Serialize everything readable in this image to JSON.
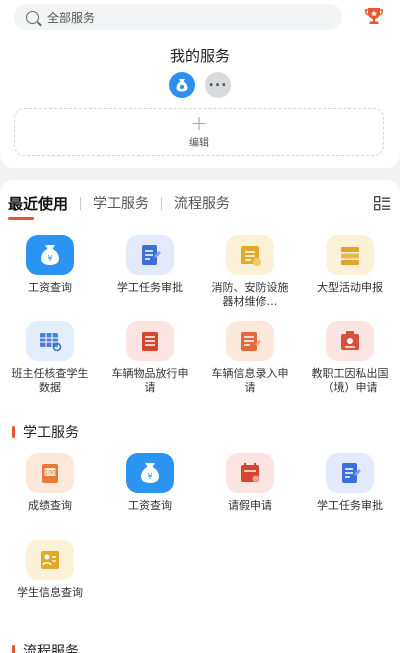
{
  "search": {
    "placeholder": "全部服务"
  },
  "my_services": {
    "title": "我的服务",
    "edit_label": "编辑"
  },
  "tabs": [
    {
      "label": "最近使用",
      "active": true
    },
    {
      "label": "学工服务",
      "active": false
    },
    {
      "label": "流程服务",
      "active": false
    }
  ],
  "recent": [
    {
      "label": "工资查询",
      "icon": "money-bag-icon"
    },
    {
      "label": "学工任务审批",
      "icon": "approval-doc-icon"
    },
    {
      "label": "消防、安防设施器材维修…",
      "icon": "repair-doc-icon"
    },
    {
      "label": "大型活动申报",
      "icon": "event-stack-icon"
    },
    {
      "label": "班主任核查学生数据",
      "icon": "data-check-icon"
    },
    {
      "label": "车辆物品放行申请",
      "icon": "vehicle-pass-icon"
    },
    {
      "label": "车辆信息录入申请",
      "icon": "vehicle-info-icon"
    },
    {
      "label": "教职工因私出国（境）申请",
      "icon": "travel-abroad-icon"
    }
  ],
  "student_affairs": {
    "title": "学工服务",
    "items": [
      {
        "label": "成绩查询",
        "icon": "score-icon"
      },
      {
        "label": "工资查询",
        "icon": "money-bag-icon"
      },
      {
        "label": "请假申请",
        "icon": "leave-calendar-icon"
      },
      {
        "label": "学工任务审批",
        "icon": "approval-doc-icon"
      },
      {
        "label": "学生信息查询",
        "icon": "student-info-icon"
      }
    ]
  },
  "process_services": {
    "title": "流程服务"
  },
  "colors": {
    "accent": "#e8552f",
    "primary_blue": "#2b93f2"
  }
}
